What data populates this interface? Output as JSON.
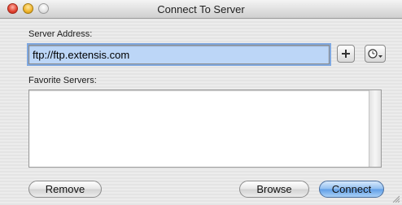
{
  "window": {
    "title": "Connect To Server"
  },
  "server_address": {
    "label": "Server Address:",
    "value": "ftp://ftp.extensis.com"
  },
  "favorites": {
    "label": "Favorite Servers:",
    "items": []
  },
  "buttons": {
    "remove": "Remove",
    "browse": "Browse",
    "connect": "Connect"
  },
  "icons": {
    "add": "plus-icon",
    "recent": "clock-dropdown-icon"
  },
  "colors": {
    "accent": "#5f9de6",
    "selection": "#bcd6f7",
    "close": "#e0412f",
    "minimize": "#f0b42a"
  }
}
